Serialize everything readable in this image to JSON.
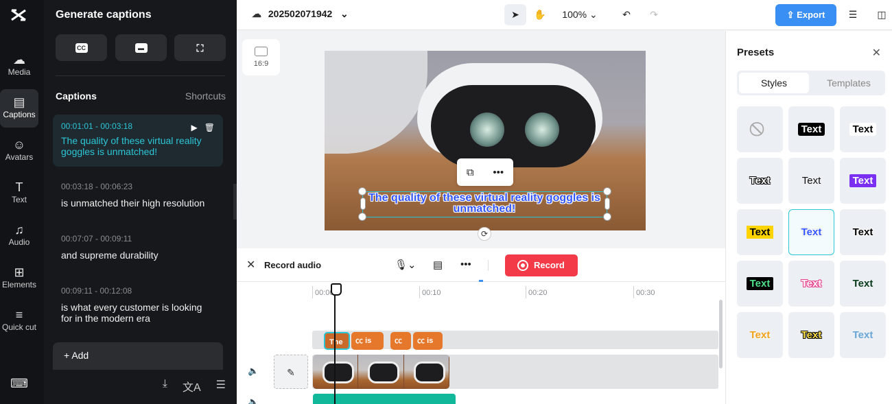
{
  "rail": {
    "items": [
      {
        "label": "Media",
        "icon": "cloud-upload-icon"
      },
      {
        "label": "Captions",
        "icon": "captions-icon"
      },
      {
        "label": "Avatars",
        "icon": "avatar-icon"
      },
      {
        "label": "Text",
        "icon": "text-icon"
      },
      {
        "label": "Audio",
        "icon": "music-icon"
      },
      {
        "label": "Elements",
        "icon": "elements-icon"
      },
      {
        "label": "Quick cut",
        "icon": "quick-cut-icon"
      }
    ]
  },
  "panel": {
    "title": "Generate captions",
    "section_title": "Captions",
    "shortcuts_label": "Shortcuts",
    "captions": [
      {
        "time": "00:01:01 - 00:03:18",
        "text": "The quality of these virtual reality goggles is unmatched!"
      },
      {
        "time": "00:03:18 - 00:06:23",
        "text": "is unmatched their high resolution"
      },
      {
        "time": "00:07:07 - 00:09:11",
        "text": "and supreme durability"
      },
      {
        "time": "00:09:11 - 00:12:08",
        "text": "is what every customer is looking for in the modern era"
      }
    ],
    "add_label": "Add"
  },
  "topbar": {
    "project_name": "202502071942",
    "zoom": "100%",
    "export_label": "Export"
  },
  "canvas": {
    "ratio_label": "16:9",
    "subtitle": "The quality of these virtual reality goggles is unmatched!"
  },
  "recbar": {
    "label": "Record audio",
    "record_label": "Record"
  },
  "timeline": {
    "ticks": [
      "00:00",
      "00:10",
      "00:20",
      "00:30"
    ],
    "chips": [
      "The",
      "is",
      "",
      "is"
    ]
  },
  "presets": {
    "title": "Presets",
    "tabs": [
      "Styles",
      "Templates"
    ],
    "tile_text": "Text"
  },
  "colors": {
    "accent": "#2bc6d6",
    "export": "#3a8ff5",
    "record": "#f23a49",
    "caption_chip": "#e5782a"
  }
}
